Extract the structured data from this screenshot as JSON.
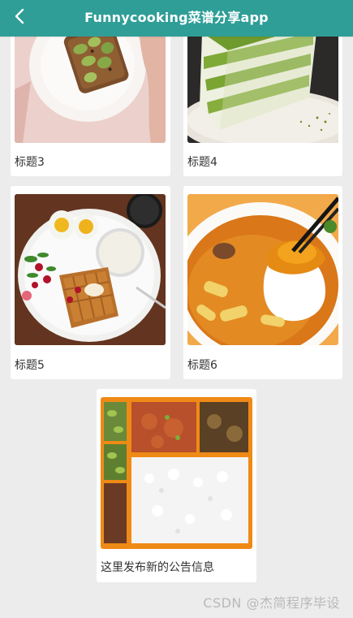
{
  "header": {
    "title": "Funnycooking菜谱分享app",
    "back_icon": "chevron-left-icon",
    "background": "#2f9e97"
  },
  "cards": [
    {
      "label": "标题3",
      "image": "avocado-toast-photo"
    },
    {
      "label": "标题4",
      "image": "matcha-layer-cake-photo"
    },
    {
      "label": "标题5",
      "image": "breakfast-waffle-plate-photo"
    },
    {
      "label": "标题6",
      "image": "rice-with-egg-sauce-photo"
    }
  ],
  "notice": {
    "label": "这里发布新的公告信息",
    "image": "bento-rice-box-photo"
  },
  "watermark": "CSDN @杰简程序毕设"
}
